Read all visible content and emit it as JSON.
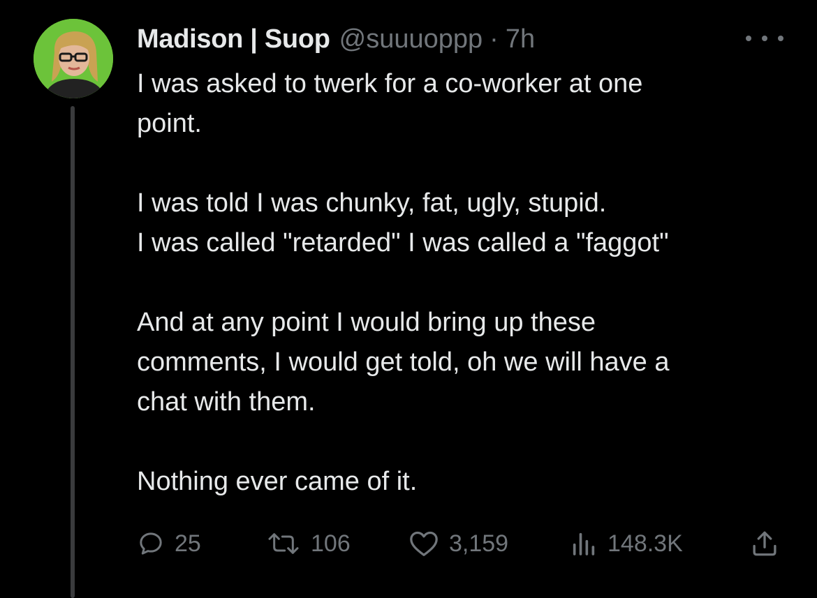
{
  "tweet": {
    "author_name": "Madison | Suop",
    "handle": "@suuuoppp",
    "separator": "·",
    "time": "7h",
    "paragraphs": [
      [
        "I was asked to twerk for a co-worker at one",
        "point."
      ],
      [
        "I was told I was chunky, fat, ugly, stupid.",
        "I was called \"retarded\" I was called a \"faggot\""
      ],
      [
        "And at any point I would bring up these",
        "comments, I would get told, oh we will have a",
        "chat with them."
      ],
      [
        "Nothing ever came of it."
      ]
    ]
  },
  "actions": {
    "replies": "25",
    "retweets": "106",
    "likes": "3,159",
    "views": "148.3K"
  },
  "icons": {
    "more": "more-horizontal-icon",
    "reply": "reply-bubble-icon",
    "retweet": "retweet-icon",
    "like": "heart-icon",
    "views": "views-bar-chart-icon",
    "share": "share-upload-icon"
  },
  "colors": {
    "background": "#000000",
    "text_primary": "#e7e9ea",
    "text_secondary": "#71767b",
    "avatar_bg": "#6cc33a"
  }
}
